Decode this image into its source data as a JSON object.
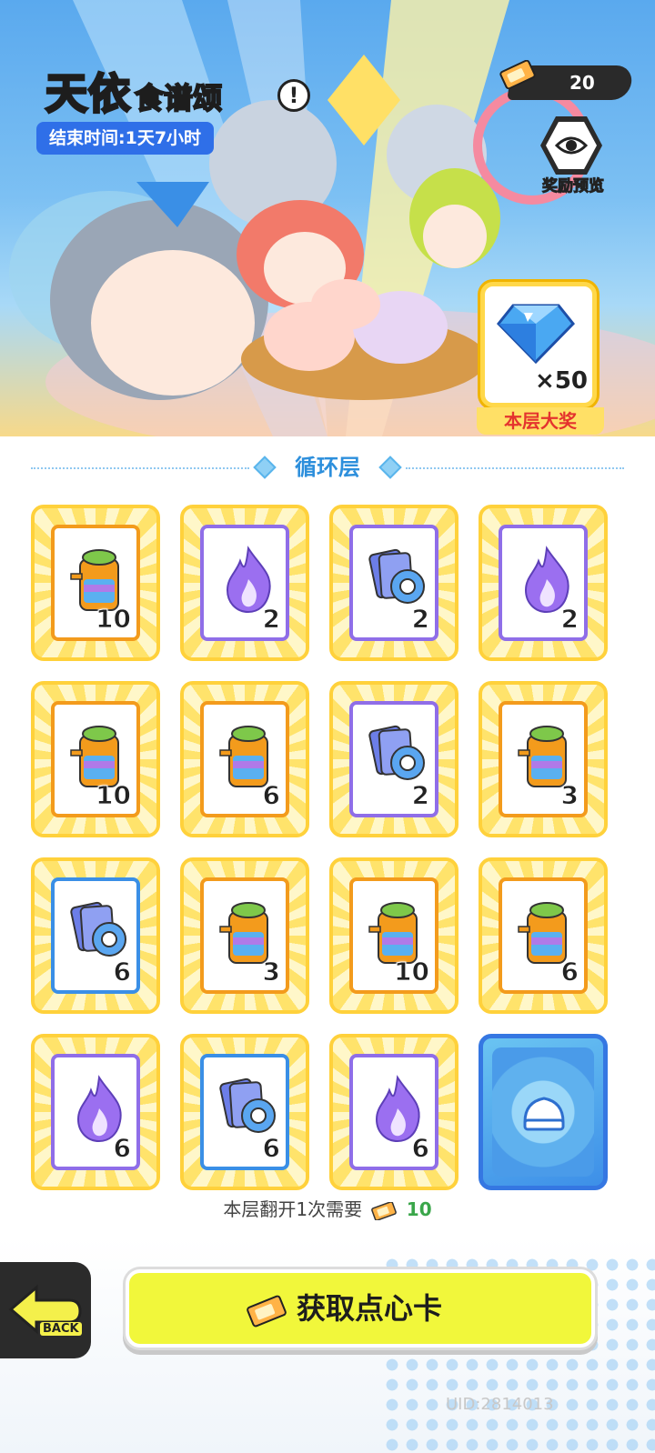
{
  "header": {
    "title_main": "天依",
    "title_sub": "食谱颂",
    "info_label": "!",
    "end_time": "结束时间:1天7小时",
    "ticket_count": "20",
    "reward_preview_label": "奖励预览"
  },
  "grand_prize": {
    "quantity": "×50",
    "label": "本层大奖",
    "icon": "diamond-gem-icon"
  },
  "section": {
    "title": "循环层"
  },
  "tiles": [
    {
      "icon": "jar-icon",
      "qty": "10",
      "color": "orange"
    },
    {
      "icon": "purple-flame-icon",
      "qty": "2",
      "color": "purple"
    },
    {
      "icon": "tape-cards-icon",
      "qty": "2",
      "color": "purple"
    },
    {
      "icon": "purple-flame-icon",
      "qty": "2",
      "color": "purple"
    },
    {
      "icon": "jar-icon",
      "qty": "10",
      "color": "orange"
    },
    {
      "icon": "jar-icon",
      "qty": "6",
      "color": "orange"
    },
    {
      "icon": "tape-cards-icon",
      "qty": "2",
      "color": "purple"
    },
    {
      "icon": "jar-icon",
      "qty": "3",
      "color": "orange"
    },
    {
      "icon": "tape-cards-icon",
      "qty": "6",
      "color": "blue"
    },
    {
      "icon": "jar-icon",
      "qty": "3",
      "color": "orange"
    },
    {
      "icon": "jar-icon",
      "qty": "10",
      "color": "orange"
    },
    {
      "icon": "jar-icon",
      "qty": "6",
      "color": "orange"
    },
    {
      "icon": "purple-flame-icon",
      "qty": "6",
      "color": "purple"
    },
    {
      "icon": "tape-cards-icon",
      "qty": "6",
      "color": "blue"
    },
    {
      "icon": "purple-flame-icon",
      "qty": "6",
      "color": "purple"
    },
    {
      "icon": "card-back-bun-icon",
      "qty": "",
      "color": "back"
    }
  ],
  "cost": {
    "prefix": "本层翻开1次需要",
    "amount": "10"
  },
  "footer": {
    "back_label": "BACK",
    "get_cards_label": "获取点心卡",
    "uid": "UID:2814013"
  },
  "colors": {
    "accent_yellow": "#f1f73b",
    "endtime_blue": "#2f6fe8",
    "prize_red": "#e4332e",
    "section_blue": "#2d8fdc"
  }
}
